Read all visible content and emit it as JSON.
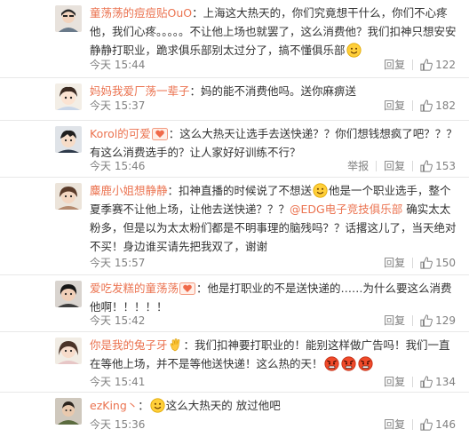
{
  "labels": {
    "reply": "回复",
    "report": "举报"
  },
  "colors": {
    "username": "#eb7350",
    "meta": "#808080",
    "divider": "#e8e8e8"
  },
  "comments": [
    {
      "username": "童荡荡的痘痘贴OuO",
      "text": "：上海这大热天的，你们究竟想干什么，你们不心疼他，我们心疼。。。。。不让他上场也就罢了，这么消费他？我们扣神只想安安静静打职业，跪求俱乐部别太过分了，搞不懂俱乐部",
      "emoji_after": "smile-emoji",
      "time": "今天 15:44",
      "likes": "122"
    },
    {
      "username": "妈妈我爱厂荡一辈子",
      "text": "：妈的能不消费他吗。送你麻痹送",
      "time": "今天 15:37",
      "likes": "182"
    },
    {
      "username": "Korol的可爱",
      "badge": "heart-badge",
      "text": "：这么大热天让选手去送快递？？你们想钱想疯了吧？？？有这么消费选手的？让人家好好训练不行？",
      "time": "今天 15:46",
      "has_report": true,
      "likes": "153"
    },
    {
      "username": "麋鹿小姐想静静",
      "text_a": "：扣神直播的时候说了不想送",
      "text_b": "他是一个职业选手，整个夏季赛不让他上场，让他去送快递？？？",
      "mention": "@EDG电子竞技俱乐部",
      "text_c": " 确实太太粉多，但是以为太太粉们都是不明事理的脑残吗？？话撂这儿了，当天绝对不买！身边谁买请先把我双了，谢谢",
      "time": "今天 15:57",
      "likes": "150"
    },
    {
      "username": "爱吃发糕的童荡荡",
      "badge": "heart-badge",
      "text": "：他是打职业的不是送快递的……为什么要这么消费他啊！！！！！",
      "time": "今天 15:42",
      "likes": "129"
    },
    {
      "username": "你是我的兔子牙",
      "badge": "clap-badge",
      "text": "：我们扣神要打职业的！能别这样做广告吗！我们一直在等他上场，并不是等他送快递！这么热的天！",
      "time": "今天 15:41",
      "likes": "134"
    },
    {
      "username": "ezKing丶",
      "text": "这么大热天的 放过他吧",
      "time": "今天 15:36",
      "likes": "146"
    }
  ]
}
